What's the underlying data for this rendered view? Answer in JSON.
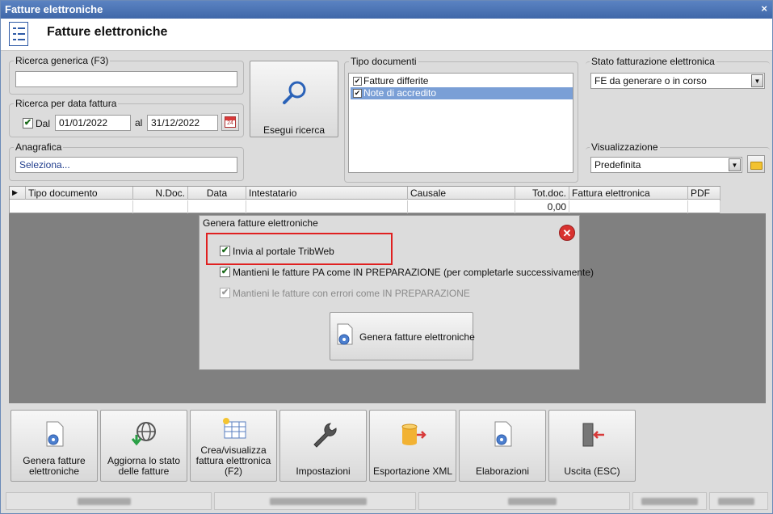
{
  "window": {
    "title": "Fatture elettroniche",
    "close_glyph": "×"
  },
  "header": {
    "title": "Fatture elettroniche",
    "icon": "list-document-icon"
  },
  "search": {
    "generic_legend": "Ricerca generica (F3)",
    "generic_value": "",
    "date_legend": "Ricerca per data fattura",
    "dal_checked": true,
    "dal_label": "Dal",
    "date_from": "01/01/2022",
    "al_label": "al",
    "date_to": "31/12/2022",
    "anagrafica_legend": "Anagrafica",
    "anagrafica_value": "Seleziona...",
    "search_button": "Esegui ricerca"
  },
  "doc_types": {
    "legend": "Tipo documenti",
    "items": [
      {
        "label": "Fatture differite",
        "checked": true,
        "selected": false
      },
      {
        "label": "Note di accredito",
        "checked": true,
        "selected": true
      }
    ]
  },
  "stato": {
    "legend": "Stato fatturazione elettronica",
    "value": "FE da generare o in corso"
  },
  "visualizzazione": {
    "legend": "Visualizzazione",
    "value": "Predefinita"
  },
  "grid": {
    "columns": [
      "Tipo documento",
      "N.Doc.",
      "Data",
      "Intestatario",
      "Causale",
      "Tot.doc.",
      "Fattura elettronica",
      "PDF"
    ],
    "total": "0,00",
    "row_marker": "▶"
  },
  "dialog": {
    "legend": "Genera fatture elettroniche",
    "opt1": "Invia al portale TribWeb",
    "opt2": "Mantieni le fatture PA come IN PREPARAZIONE (per completarle successivamente)",
    "opt3": "Mantieni le fatture con errori come IN PREPARAZIONE",
    "button": "Genera fatture elettroniche",
    "close_glyph": "✕"
  },
  "toolbar": {
    "items": [
      {
        "label": "Genera fatture elettroniche",
        "icon": "document-gear-icon"
      },
      {
        "label": "Aggiorna lo stato delle fatture",
        "icon": "globe-download-icon"
      },
      {
        "label": "Crea/visualizza fattura elettronica (F2)",
        "icon": "table-sun-icon"
      },
      {
        "label": "Impostazioni",
        "icon": "wrench-icon"
      },
      {
        "label": "Esportazione XML",
        "icon": "database-export-icon"
      },
      {
        "label": "Elaborazioni",
        "icon": "document-gear-icon"
      },
      {
        "label": "Uscita (ESC)",
        "icon": "exit-door-icon"
      }
    ]
  },
  "colors": {
    "titlebar": "#4a72b5",
    "selection": "#7a9fd6",
    "highlight_box": "#e02020",
    "dark_panel": "#808080"
  }
}
